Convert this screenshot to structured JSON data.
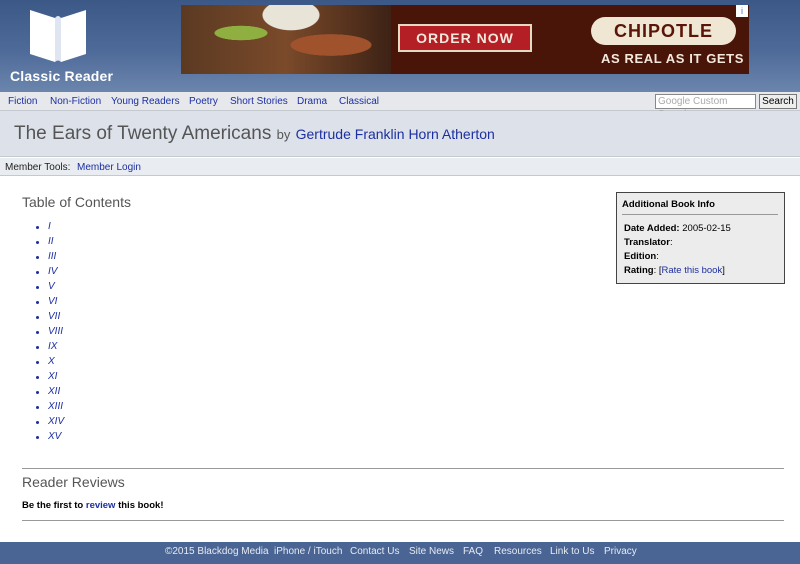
{
  "brand": {
    "name": "Classic Reader"
  },
  "ad": {
    "cta": "ORDER NOW",
    "brand": "CHIPOTLE",
    "tagline": "AS REAL AS IT GETS",
    "info_glyph": "i"
  },
  "nav": {
    "items": [
      "Fiction",
      "Non-Fiction",
      "Young Readers",
      "Poetry",
      "Short Stories",
      "Drama",
      "Classical"
    ],
    "search_placeholder": "Google Custom Search",
    "search_button": "Search"
  },
  "book": {
    "title": "The Ears of Twenty Americans",
    "by": "by",
    "author": "Gertrude Franklin Horn Atherton"
  },
  "member": {
    "label": "Member Tools:",
    "login": "Member Login"
  },
  "toc": {
    "title": "Table of Contents",
    "chapters": [
      "I",
      "II",
      "III",
      "IV",
      "V",
      "VI",
      "VII",
      "VIII",
      "IX",
      "X",
      "XI",
      "XII",
      "XIII",
      "XIV",
      "XV"
    ]
  },
  "info": {
    "title": "Additional Book Info",
    "date_label": "Date Added:",
    "date_value": "2005-02-15",
    "translator_label": "Translator",
    "edition_label": "Edition",
    "rating_label": "Rating",
    "rating_link": "Rate this book"
  },
  "reviews": {
    "title": "Reader Reviews",
    "prefix": "Be the first to",
    "link": "review",
    "suffix": "this book!"
  },
  "footer": {
    "items": [
      "©2015 Blackdog Media",
      "iPhone / iTouch",
      "Contact Us",
      "Site News",
      "FAQ",
      "Resources",
      "Link to Us",
      "Privacy"
    ]
  }
}
